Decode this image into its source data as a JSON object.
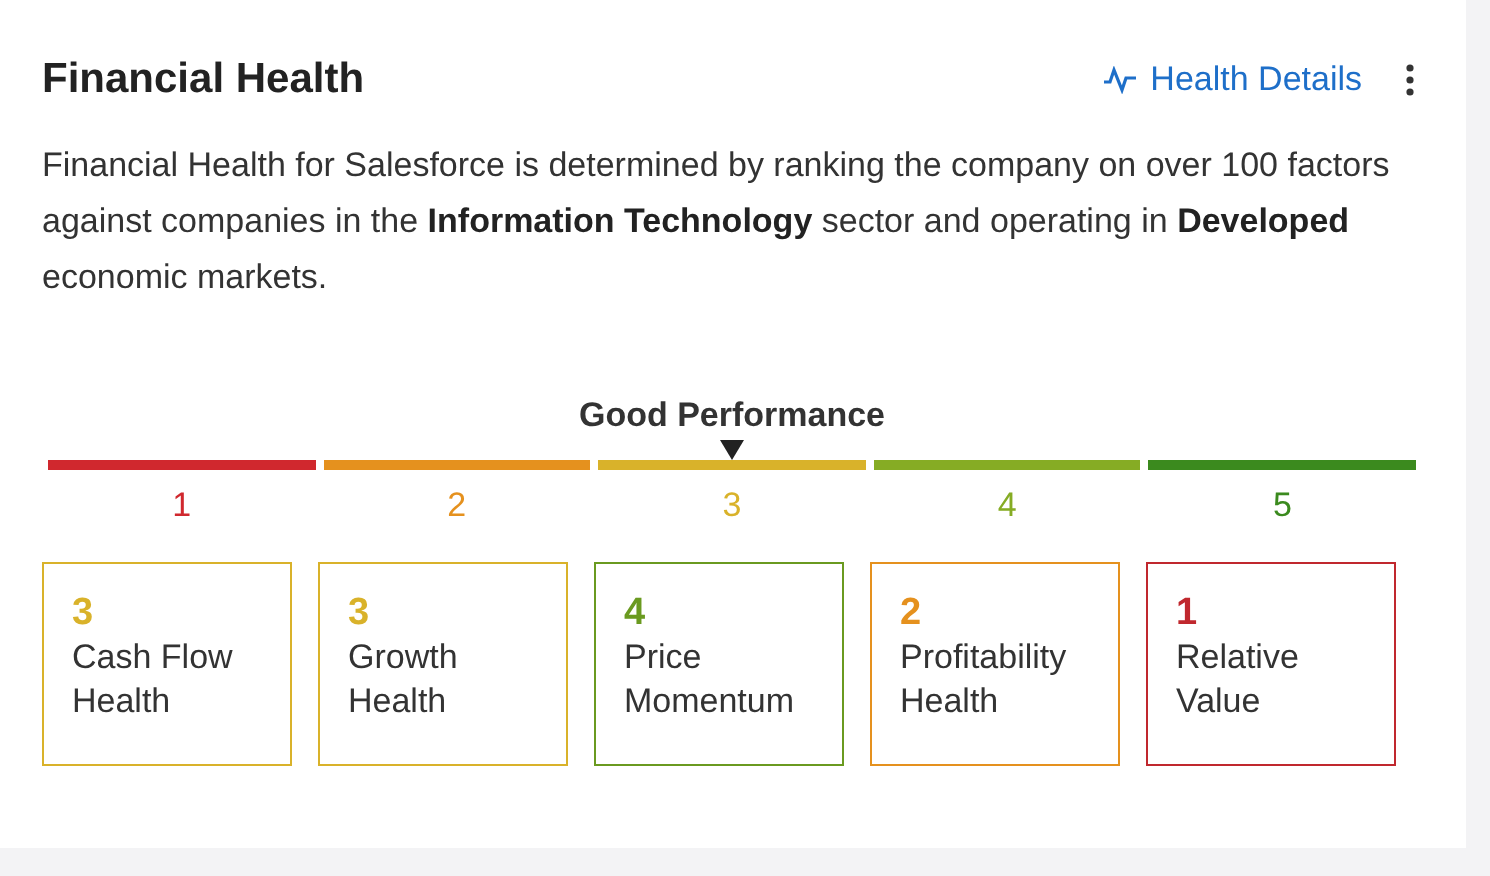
{
  "header": {
    "title": "Financial Health",
    "link": "Health Details"
  },
  "description": "Financial Health for Salesforce is determined by ranking the company on over 100 factors against companies in the **Information Technology** sector and operating in **Developed** economic markets.",
  "scale": {
    "label": "Good Performance",
    "segments": [
      {
        "label": "1",
        "color": "#d0282e",
        "selected": false
      },
      {
        "label": "2",
        "color": "#e5911e",
        "selected": false
      },
      {
        "label": "3",
        "color": "#d9b22a",
        "selected": true
      },
      {
        "label": "4",
        "color": "#86ac24",
        "selected": false
      },
      {
        "label": "5",
        "color": "#3b8a1e",
        "selected": false
      }
    ]
  },
  "metrics": [
    {
      "score": "3",
      "label": "Cash Flow Health",
      "color": "#d9b22a"
    },
    {
      "score": "3",
      "label": "Growth Health",
      "color": "#d9b22a"
    },
    {
      "score": "4",
      "label": "Price Momentum",
      "color": "#6a9a20"
    },
    {
      "score": "2",
      "label": "Profitability Health",
      "color": "#e5911e"
    },
    {
      "score": "1",
      "label": "Relative Value",
      "color": "#c0282e"
    }
  ]
}
